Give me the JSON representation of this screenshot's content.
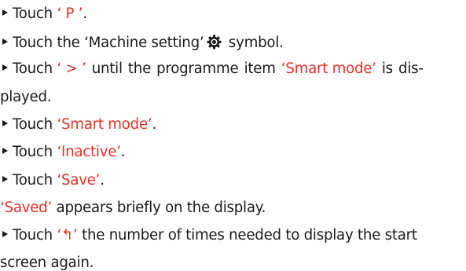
{
  "steps": [
    {
      "pre": "Touch ",
      "hl": "‘ P ’",
      "post": "."
    },
    {
      "pre": "Touch the ",
      "hl": "‘Machine setting’",
      "post": " symbol.",
      "icon": "gear-icon"
    },
    {
      "line1_pre": "Touch ",
      "line1_hl1": "‘ > ’",
      "line1_mid": " until the programme item ",
      "line1_hl2": "‘Smart mode’",
      "line1_post": " is dis-",
      "line2": "played."
    },
    {
      "pre": "Touch ",
      "hl": "‘Smart mode’",
      "post": "."
    },
    {
      "pre": "Touch ",
      "hl": "‘Inactive’",
      "post": "."
    },
    {
      "pre": "Touch ",
      "hl": "‘Save’",
      "post": "."
    }
  ],
  "note": {
    "hl": "‘Saved’",
    "post": " appears briefly on the display."
  },
  "final_step": {
    "pre": "Touch ",
    "hl": "‘↰’",
    "post": " the number of times needed to display the start",
    "line2": "screen again."
  },
  "colors": {
    "highlight": "#e2332b",
    "text": "#1a1a1a"
  }
}
